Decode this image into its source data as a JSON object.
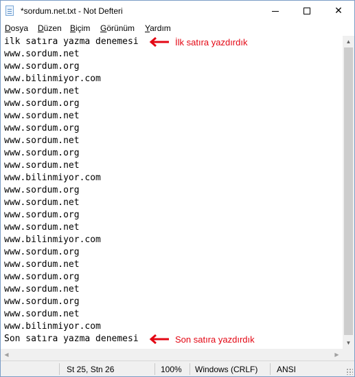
{
  "window": {
    "title": "*sordum.net.txt - Not Defteri",
    "icon": "notepad-icon",
    "controls": {
      "minimize": "minimize-icon",
      "maximize": "maximize-icon",
      "close_glyph": "✕"
    }
  },
  "menu": [
    {
      "accel": "D",
      "rest": "osya"
    },
    {
      "accel": "D",
      "rest": "üzen"
    },
    {
      "accel": "B",
      "rest": "içim"
    },
    {
      "accel": "G",
      "rest": "örünüm"
    },
    {
      "accel": "Y",
      "rest": "ardım"
    }
  ],
  "editor": {
    "lines": [
      "ilk satıra yazma denemesi",
      "www.sordum.net",
      "www.sordum.org",
      "www.bilinmiyor.com",
      "www.sordum.net",
      "www.sordum.org",
      "www.sordum.net",
      "www.sordum.org",
      "www.sordum.net",
      "www.sordum.org",
      "www.sordum.net",
      "www.bilinmiyor.com",
      "www.sordum.org",
      "www.sordum.net",
      "www.sordum.org",
      "www.sordum.net",
      "www.bilinmiyor.com",
      "www.sordum.org",
      "www.sordum.net",
      "www.sordum.org",
      "www.sordum.net",
      "www.sordum.org",
      "www.sordum.net",
      "www.bilinmiyor.com",
      "Son satıra yazma denemesi"
    ],
    "annotations": {
      "first": {
        "text": "İlk satıra yazdırdık",
        "arrow_icon": "red-arrow-left-icon",
        "color": "#e30613"
      },
      "last": {
        "text": "Son satıra yazdırdık",
        "arrow_icon": "red-arrow-left-icon",
        "color": "#e30613"
      }
    }
  },
  "statusbar": {
    "position": "St 25, Stn 26",
    "zoom": "100%",
    "line_endings": "Windows (CRLF)",
    "encoding": "ANSI"
  }
}
